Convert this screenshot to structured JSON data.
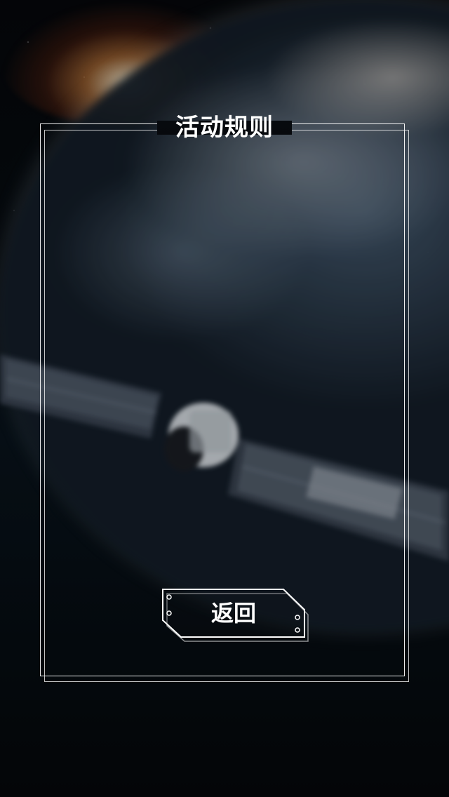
{
  "page": {
    "title": "活动规则"
  },
  "actions": {
    "back_label": "返回"
  },
  "colors": {
    "frame": "#ffffff",
    "text": "#ffffff",
    "background": "#05070a"
  }
}
